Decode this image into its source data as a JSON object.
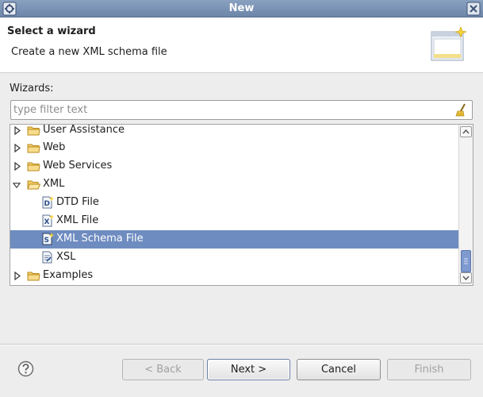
{
  "window": {
    "title": "New"
  },
  "header": {
    "title": "Select a wizard",
    "description": "Create a new XML schema file"
  },
  "wizards_label": "Wizards:",
  "filter": {
    "value": "",
    "placeholder": "type filter text"
  },
  "tree": {
    "items": [
      {
        "label": "User Assistance",
        "type": "folder",
        "expanded": false,
        "depth": 0
      },
      {
        "label": "Web",
        "type": "folder",
        "expanded": false,
        "depth": 0
      },
      {
        "label": "Web Services",
        "type": "folder",
        "expanded": false,
        "depth": 0
      },
      {
        "label": "XML",
        "type": "folder",
        "expanded": true,
        "depth": 0
      },
      {
        "label": "DTD File",
        "type": "file",
        "icon_letter": "D",
        "depth": 1
      },
      {
        "label": "XML File",
        "type": "file",
        "icon_letter": "X",
        "depth": 1
      },
      {
        "label": "XML Schema File",
        "type": "file",
        "icon_letter": "S",
        "depth": 1,
        "selected": true
      },
      {
        "label": "XSL",
        "type": "file",
        "icon_letter": "",
        "depth": 1
      },
      {
        "label": "Examples",
        "type": "folder",
        "expanded": false,
        "depth": 0
      }
    ]
  },
  "buttons": {
    "back": "< Back",
    "next": "Next >",
    "cancel": "Cancel",
    "finish": "Finish"
  },
  "colors": {
    "titlebar": "#7690b4",
    "selection": "#6e8cc0",
    "folder": "#f2c04a"
  }
}
